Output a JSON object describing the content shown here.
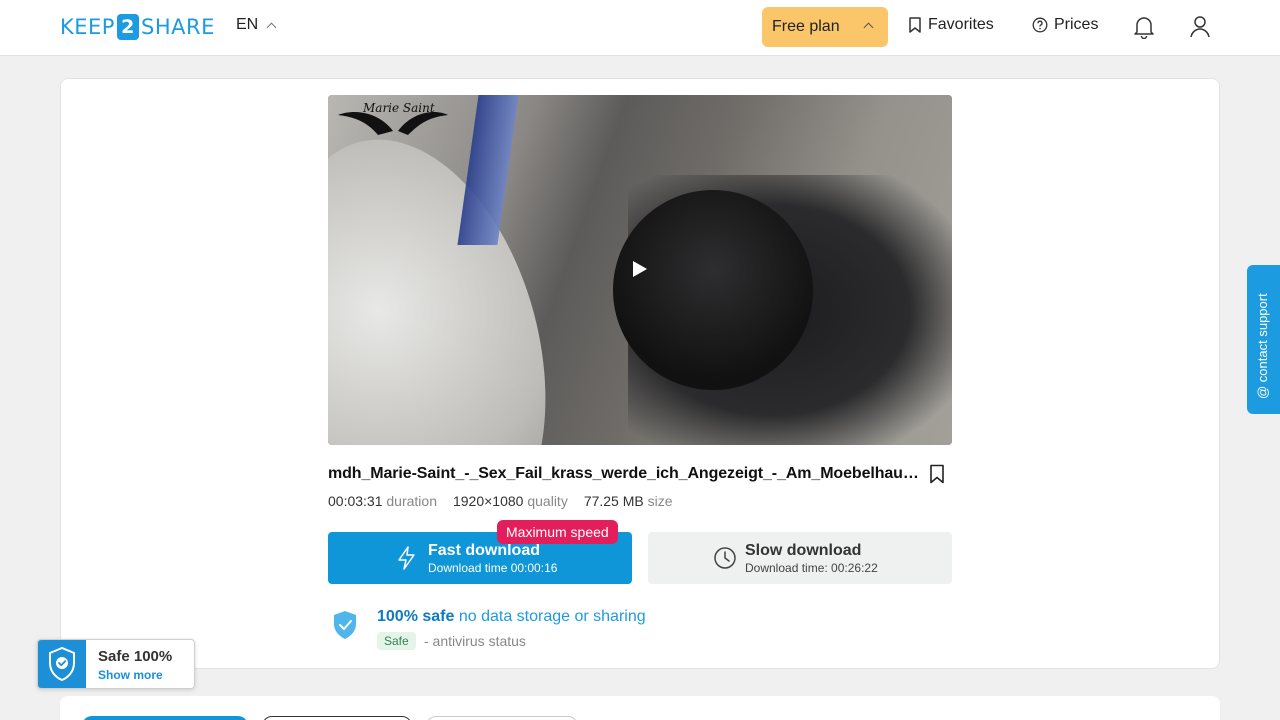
{
  "header": {
    "logo_left": "KEEP",
    "logo_num": "2",
    "logo_right": "SHARE",
    "lang": "EN",
    "plan": "Free plan",
    "favorites": "Favorites",
    "prices": "Prices"
  },
  "file": {
    "title": "mdh_Marie-Saint_-_Sex_Fail_krass_werde_ich_Angezeigt_-_Am_Moebelhaus_...",
    "watermark": "Marie Saint",
    "duration": "00:03:31",
    "duration_label": "duration",
    "quality": "1920×1080",
    "quality_label": "quality",
    "size": "77.25 MB",
    "size_label": "size"
  },
  "download": {
    "badge": "Maximum speed",
    "fast_label": "Fast download",
    "fast_time": "Download time 00:00:16",
    "slow_label": "Slow download",
    "slow_time": "Download time: 00:26:22"
  },
  "safety": {
    "headline_bold": "100% safe",
    "headline_rest": "no data storage or sharing",
    "badge": "Safe",
    "status": "- antivirus status"
  },
  "support": {
    "label": "@ contact support"
  },
  "widget": {
    "title": "Safe 100%",
    "link": "Show more"
  },
  "colors": {
    "accent": "#1d9be0",
    "plan": "#fbc66a",
    "badge": "#e21e5c"
  }
}
